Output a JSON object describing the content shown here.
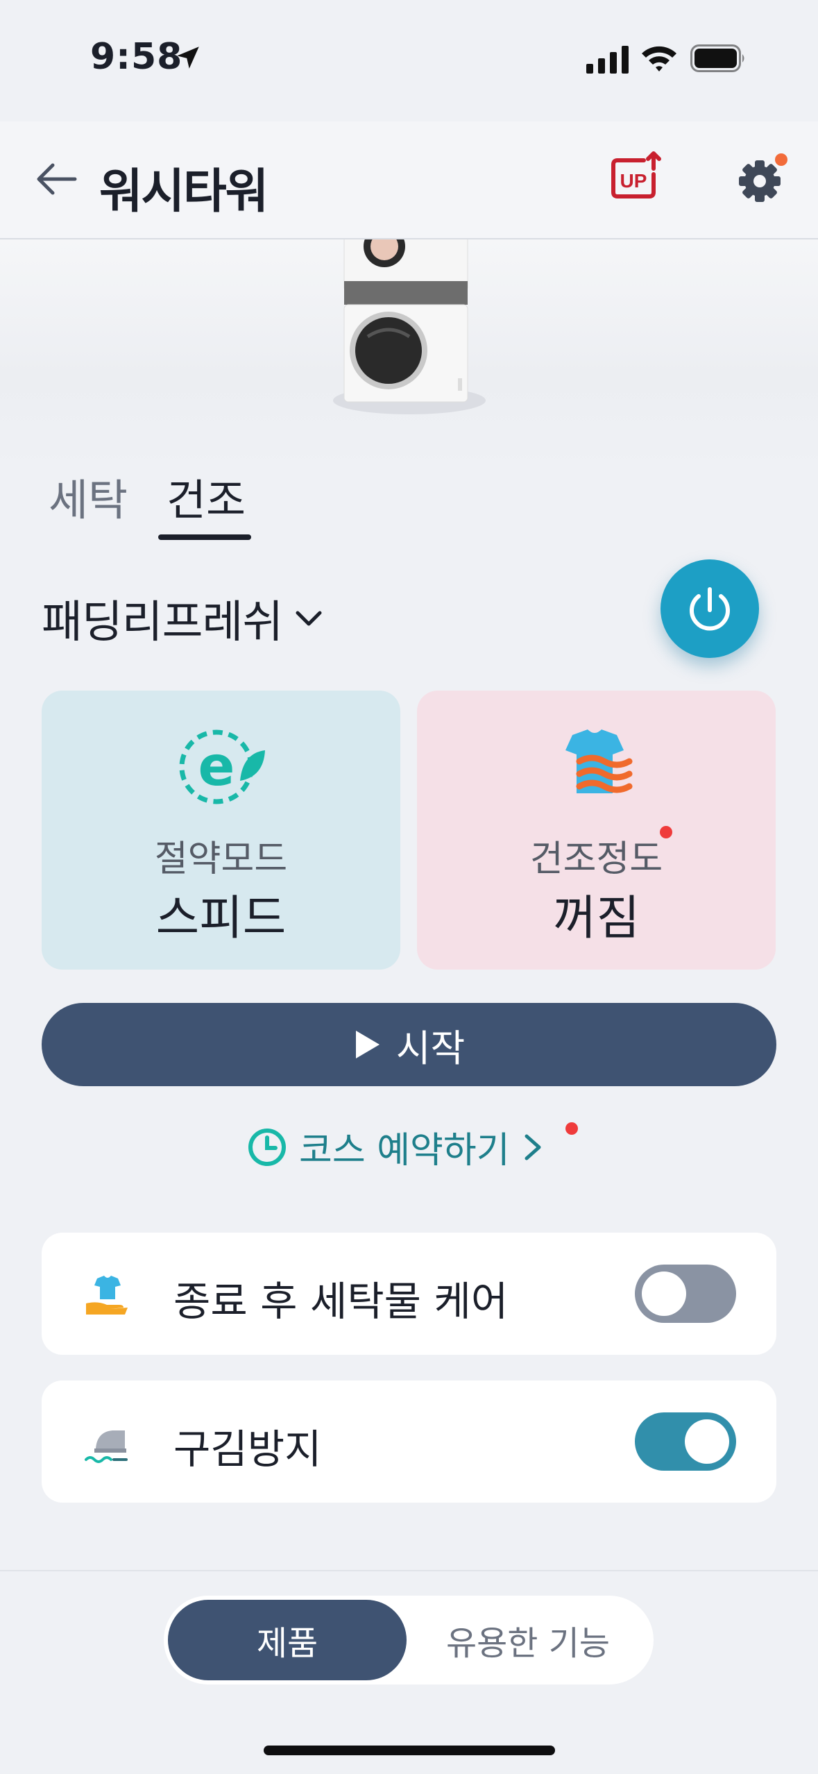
{
  "status_bar": {
    "time": "9:58"
  },
  "header": {
    "title": "워시타워"
  },
  "tabs": [
    {
      "label": "세탁",
      "selected": false
    },
    {
      "label": "건조",
      "selected": true
    }
  ],
  "course": {
    "name": "패딩리프레쉬"
  },
  "cards": {
    "eco": {
      "label": "절약모드",
      "value": "스피드"
    },
    "dry": {
      "label": "건조정도",
      "value": "꺼짐"
    }
  },
  "start": {
    "label": "시작"
  },
  "reserve": {
    "label": "코스 예약하기"
  },
  "options": [
    {
      "label": "종료 후 세탁물 케어",
      "enabled": false
    },
    {
      "label": "구김방지",
      "enabled": true
    }
  ],
  "bottom_nav": {
    "product": "제품",
    "features": "유용한 기능"
  },
  "colors": {
    "accent": "#1d9fc5",
    "primary_button": "#3f5372",
    "toggle_on": "#318fab",
    "toggle_off": "#8a93a3",
    "eco_card": "#d7e9ef",
    "dry_card": "#f5e0e7",
    "notification": "#ef3b3b"
  }
}
